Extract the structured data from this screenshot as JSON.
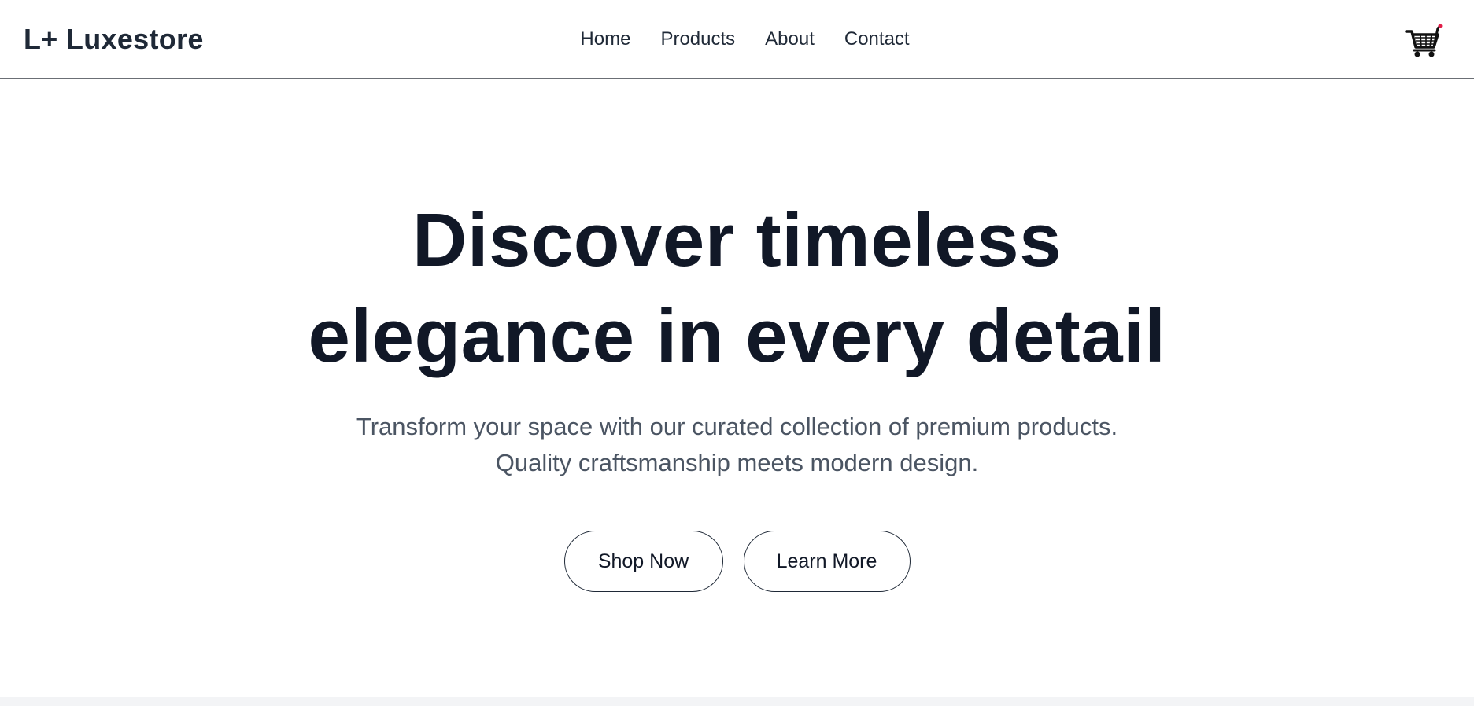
{
  "header": {
    "logo": "L+ Luxestore",
    "nav": [
      "Home",
      "Products",
      "About",
      "Contact"
    ],
    "cart_icon": "shopping-cart-icon"
  },
  "hero": {
    "title_line1": "Discover timeless",
    "title_line2": "elegance in every detail",
    "subtitle_line1": "Transform your space with our curated collection of premium products.",
    "subtitle_line2": "Quality craftsmanship meets modern design.",
    "primary_button": "Shop Now",
    "secondary_button": "Learn More"
  },
  "colors": {
    "text_dark": "#111827",
    "text_muted": "#4b5563",
    "border": "#1f2937",
    "cart_accent": "#e11d48"
  }
}
